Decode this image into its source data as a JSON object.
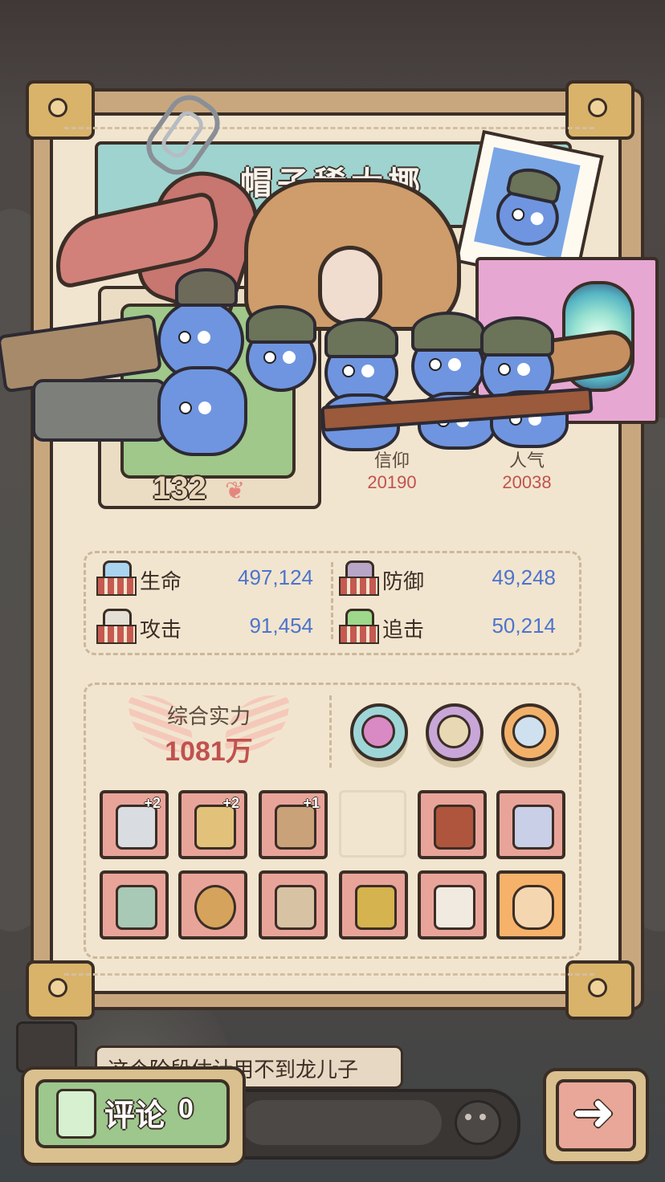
{
  "hero": {
    "name": "帽子稀大椰",
    "level": "132",
    "belief_label": "信仰",
    "belief_value": "20190",
    "popularity_label": "人气",
    "popularity_value": "20038"
  },
  "attributes": [
    {
      "label": "生命",
      "value": "497,124",
      "icon": "heart-potion-icon"
    },
    {
      "label": "防御",
      "value": "49,248",
      "icon": "shield-icon"
    },
    {
      "label": "攻击",
      "value": "91,454",
      "icon": "sword-icon"
    },
    {
      "label": "追击",
      "value": "50,214",
      "icon": "lightning-icon"
    }
  ],
  "power": {
    "label": "综合实力",
    "value": "1081万"
  },
  "skills": [
    {
      "icon": "dragon-skill-icon",
      "color": "#9ed6d8"
    },
    {
      "icon": "scroll-skill-icon",
      "color": "#c9a6d8"
    },
    {
      "icon": "mirror-skill-icon",
      "color": "#f2b16b"
    }
  ],
  "equipment_row1": [
    {
      "icon": "dagger-icon",
      "plus": "+2",
      "empty": false
    },
    {
      "icon": "gatling-gun-icon",
      "plus": "+2",
      "empty": false
    },
    {
      "icon": "sword-icon",
      "plus": "+1",
      "empty": false
    },
    {
      "icon": "",
      "plus": "",
      "empty": true
    },
    {
      "icon": "robe-icon",
      "plus": "",
      "empty": false
    },
    {
      "icon": "cape-icon",
      "plus": "",
      "empty": false
    }
  ],
  "equipment_row2": [
    {
      "icon": "hammer-icon",
      "plus": "",
      "empty": false
    },
    {
      "icon": "ring-icon",
      "plus": "",
      "empty": false
    },
    {
      "icon": "pants-icon",
      "plus": "",
      "empty": false
    },
    {
      "icon": "trident-icon",
      "plus": "",
      "empty": false
    },
    {
      "icon": "armor-icon",
      "plus": "",
      "empty": false
    },
    {
      "icon": "goggles-icon",
      "plus": "",
      "empty": false
    }
  ],
  "comment_preview": "这个阶段估计用不到龙儿子",
  "comment_button": {
    "label": "评论",
    "count": "0"
  },
  "colors": {
    "frame": "#c9a77e",
    "paper": "#f2e5cf",
    "accent_red": "#c0524e",
    "accent_blue": "#4d74cc",
    "slot_pink": "#e9a49a"
  }
}
